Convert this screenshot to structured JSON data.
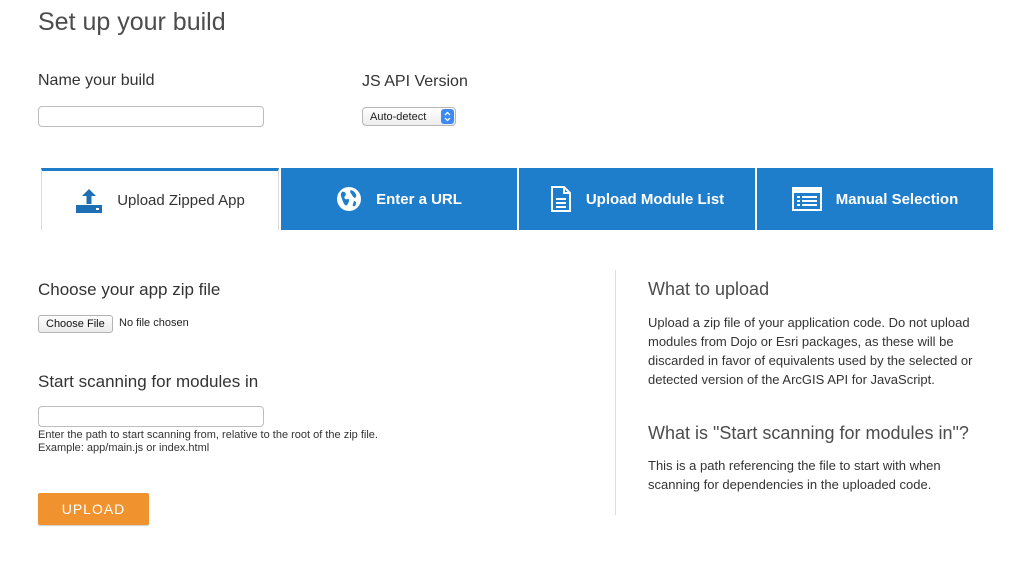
{
  "page": {
    "title": "Set up your build"
  },
  "build_name": {
    "label": "Name your build",
    "value": "",
    "placeholder": ""
  },
  "js_api": {
    "label": "JS API Version",
    "selected": "Auto-detect"
  },
  "tabs": [
    {
      "label": "Upload Zipped App",
      "icon": "upload-icon",
      "active": true
    },
    {
      "label": "Enter a URL",
      "icon": "globe-icon",
      "active": false
    },
    {
      "label": "Upload Module List",
      "icon": "document-icon",
      "active": false
    },
    {
      "label": "Manual Selection",
      "icon": "list-icon",
      "active": false
    }
  ],
  "upload": {
    "zip_label": "Choose your app zip file",
    "choose_file_label": "Choose File",
    "file_status": "No file chosen",
    "scan_label": "Start scanning for modules in",
    "scan_value": "",
    "hint_line1": "Enter the path to start scanning from, relative to the root of the zip file.",
    "hint_line2": "Example: app/main.js or index.html",
    "upload_button": "UPLOAD"
  },
  "help": {
    "what_heading": "What to upload",
    "what_text": "Upload a zip file of your application code. Do not upload modules from Dojo or Esri packages, as these will be discarded in favor of equivalents used by the selected or detected version of the ArcGIS API for JavaScript.",
    "scan_heading": "What is \"Start scanning for modules in\"?",
    "scan_text": "This is a path referencing the file to start with when scanning for dependencies in the uploaded code."
  },
  "colors": {
    "tab_blue": "#1f7ecb",
    "accent_orange": "#f0922e",
    "active_border": "#1d7cc5"
  }
}
